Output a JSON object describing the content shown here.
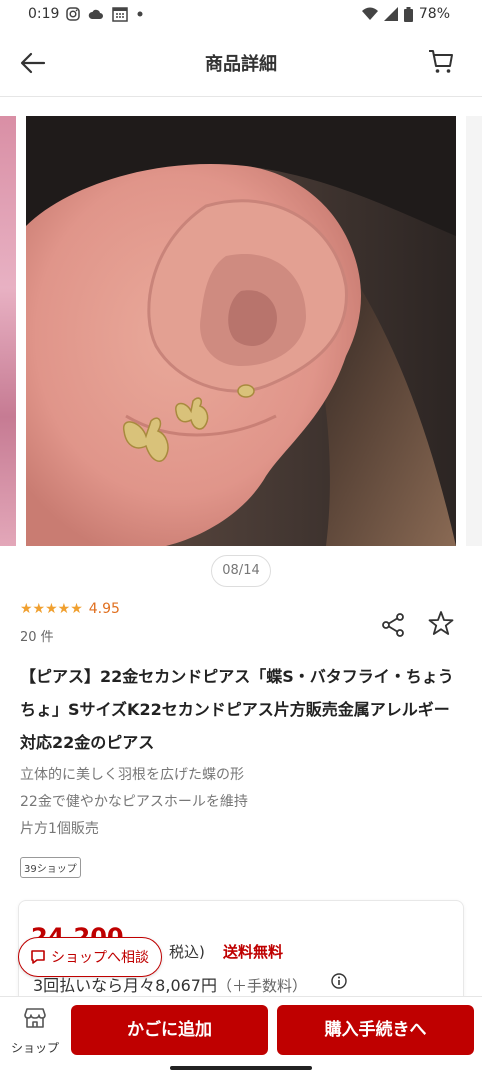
{
  "status": {
    "time": "0:19",
    "battery": "78%"
  },
  "header": {
    "title": "商品詳細"
  },
  "gallery": {
    "counter": "08/14"
  },
  "product": {
    "rating_stars": "★★★★★",
    "rating": "4.95",
    "review_count": "20 件",
    "title": "【ピアス】22金セカンドピアス「蝶S・バタフライ・ちょうちょ」SサイズK22セカンドピアス片方販売金属アレルギー対応22金のピアス",
    "features": [
      "立体的に美しく羽根を広げた蝶の形",
      "22金で健やかなピアスホールを維持",
      "片方1個販売"
    ],
    "shop_tag": "39ショップ"
  },
  "price": {
    "amount": "24,200",
    "tax_note": "税込)",
    "shipping": "送料無料",
    "installment": "3回払いなら月々8,067円",
    "installment_fee": "（＋手数料）"
  },
  "consult": {
    "label": "ショップへ相談"
  },
  "bottom": {
    "shop_label": "ショップ",
    "add_to_cart": "かごに追加",
    "checkout": "購入手続きへ"
  },
  "colors": {
    "accent": "#bf0000",
    "star": "#f0a030"
  }
}
